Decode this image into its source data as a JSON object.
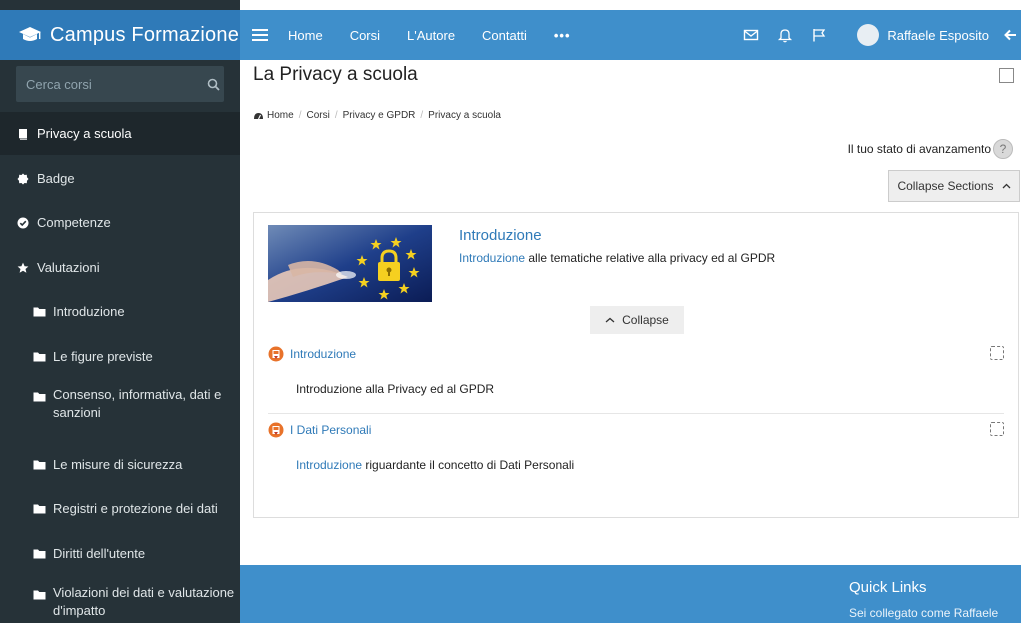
{
  "app": {
    "brand": "Campus Formazione"
  },
  "search": {
    "placeholder": "Cerca corsi"
  },
  "sidebar": {
    "items": [
      {
        "label": "Privacy a scuola"
      },
      {
        "label": "Badge"
      },
      {
        "label": "Competenze"
      },
      {
        "label": "Valutazioni"
      },
      {
        "label": "Introduzione"
      },
      {
        "label": "Le figure previste"
      },
      {
        "label": "Consenso, informativa, dati e",
        "label2": "sanzioni"
      },
      {
        "label": "Le misure di sicurezza"
      },
      {
        "label": "Registri e protezione dei dati"
      },
      {
        "label": "Diritti dell'utente"
      },
      {
        "label": "Violazioni dei dati e valutazione",
        "label2": "d'impatto"
      }
    ]
  },
  "topbar": {
    "links": [
      "Home",
      "Corsi",
      "L'Autore",
      "Contatti"
    ],
    "more": "•••",
    "user": "Raffaele Esposito"
  },
  "page": {
    "title": "La Privacy a scuola",
    "breadcrumb": [
      "Home",
      "Corsi",
      "Privacy e GPDR",
      "Privacy a scuola"
    ],
    "progress_label": "Il tuo stato di avanzamento",
    "progress_help": "?",
    "collapse_sections": "Collapse Sections"
  },
  "section": {
    "title": "Introduzione",
    "summary_link": "Introduzione",
    "summary_rest": " alle tematiche relative alla privacy ed al GPDR",
    "collapse_label": "Collapse",
    "activities": [
      {
        "name": "Introduzione",
        "desc": "Introduzione alla Privacy ed al GPDR"
      },
      {
        "name": "I Dati Personali",
        "desc_link": "Introduzione",
        "desc_rest": " riguardante il concetto di  Dati Personali"
      }
    ]
  },
  "footer": {
    "title": "Quick Links",
    "subtitle": "Sei collegato come Raffaele"
  },
  "colors": {
    "sidebar": "#263238",
    "brand": "#2f7ab8",
    "topbar": "#3f8fcb",
    "link": "#2f7ab8"
  }
}
